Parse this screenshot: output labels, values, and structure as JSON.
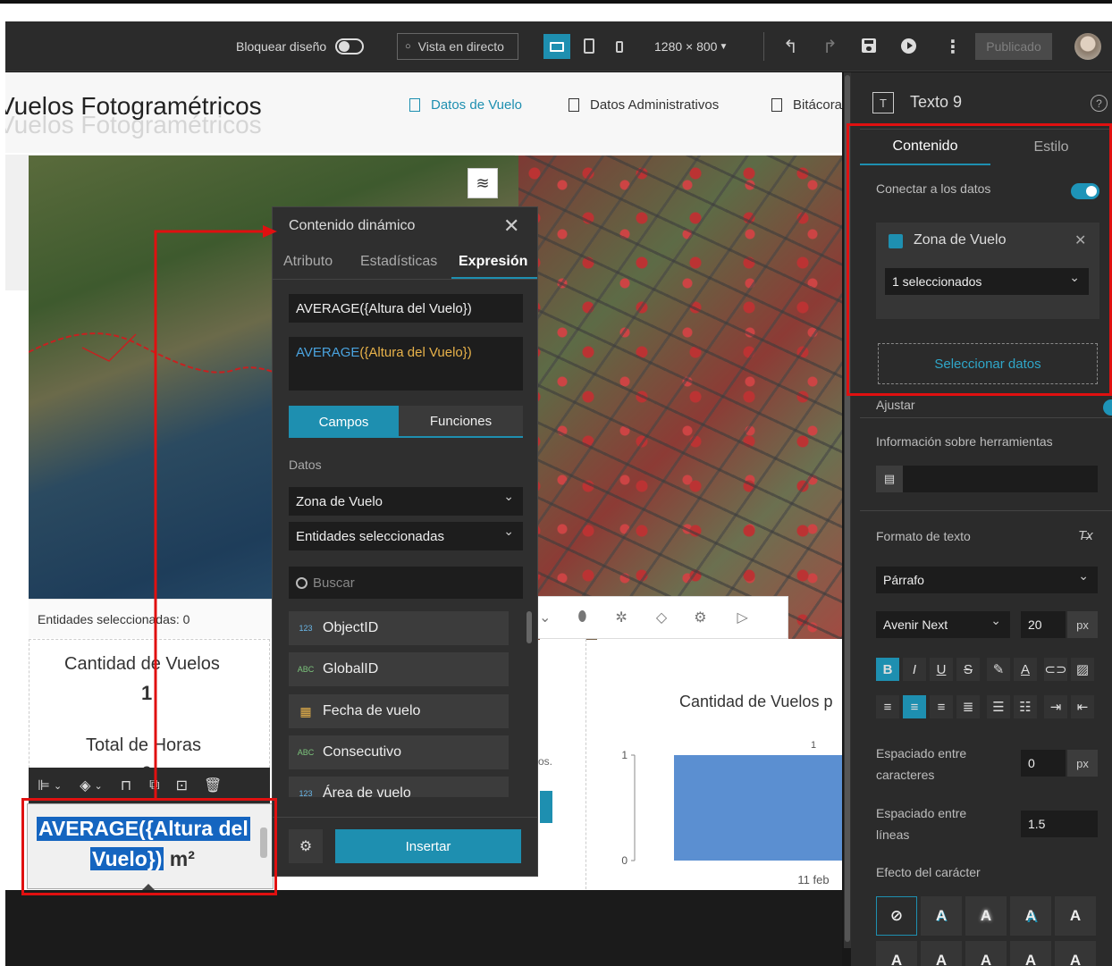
{
  "topbar": {
    "lock_label": "Bloquear diseño",
    "live_label": "Vista en directo",
    "resolution": "1280 × 800",
    "publish_label": "Publicado"
  },
  "page": {
    "title": "Vuelos Fotogramétricos",
    "title_shadow": "Vuelos Fotogramétricos",
    "nav": [
      "Datos de Vuelo",
      "Datos Administrativos",
      "Bitácora"
    ]
  },
  "map": {
    "selected_label": "Entidades seleccionadas: 0"
  },
  "stats": {
    "count_label": "Cantidad de Vuelos",
    "count_value": "1",
    "hours_label": "Total de Horas",
    "hours_value": "0"
  },
  "text_widget": {
    "line1": "AVERAGE({Altura del",
    "line2_sel": "Vuelo})",
    "line2_rest": " m²"
  },
  "chart_data": {
    "type": "bar",
    "title": "Cantidad de Vuelos p",
    "categories": [
      "11 feb"
    ],
    "values": [
      1
    ],
    "data_labels": [
      "1"
    ],
    "y_ticks": [
      "0",
      "1"
    ],
    "ylim": [
      0,
      1
    ],
    "bar_color": "#5b8fd1"
  },
  "dynamic": {
    "title": "Contenido dinámico",
    "tabs": [
      "Atributo",
      "Estadísticas",
      "Expresión"
    ],
    "expression": "AVERAGE({Altura del Vuelo})",
    "expr_func": "AVERAGE",
    "expr_arg": "({Altura del Vuelo})",
    "btn_fields": "Campos",
    "btn_functions": "Funciones",
    "datos_label": "Datos",
    "source": "Zona de Vuelo",
    "selection": "Entidades seleccionadas",
    "search_placeholder": "Buscar",
    "fields": [
      {
        "type": "123",
        "name": "ObjectID"
      },
      {
        "type": "ABC",
        "name": "GlobalID"
      },
      {
        "type": "date",
        "name": "Fecha de vuelo"
      },
      {
        "type": "ABC",
        "name": "Consecutivo"
      },
      {
        "type": "123",
        "name": "Área de vuelo"
      }
    ],
    "insert": "Insertar"
  },
  "panel": {
    "title": "Texto 9",
    "tab_content": "Contenido",
    "tab_style": "Estilo",
    "connect_label": "Conectar a los datos",
    "source_name": "Zona de Vuelo",
    "selected_count": "1 seleccionados",
    "select_data": "Seleccionar datos",
    "adjust_label": "Ajustar",
    "tooltip_label": "Información sobre herramientas",
    "text_format_label": "Formato de texto",
    "paragraph": "Párrafo",
    "font": "Avenir Next",
    "font_size": "20",
    "px": "px",
    "char_spacing_label1": "Espaciado entre",
    "char_spacing_label2": "caracteres",
    "char_spacing": "0",
    "line_spacing_label1": "Espaciado entre",
    "line_spacing_label2": "líneas",
    "line_spacing": "1.5",
    "effect_label": "Efecto del carácter"
  },
  "colors": {
    "accent": "#1e8fb0",
    "highlight": "#e01010",
    "expr_func": "#4aa3df",
    "expr_arg": "#e8b24a"
  }
}
